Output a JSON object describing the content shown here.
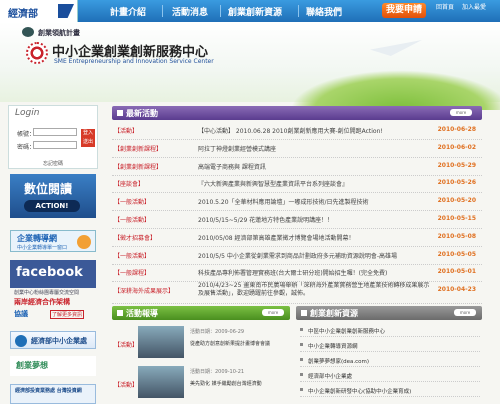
{
  "header": {
    "logo_label": "經濟部",
    "nav": [
      "計畫介紹",
      "活動消息",
      "創業創新資源",
      "聯絡我們"
    ],
    "apply_label": "我要申請",
    "util": [
      "回首頁",
      "加入最愛"
    ]
  },
  "hero": {
    "program": "創業領航計畫",
    "title": "中小企業創業創新服務中心",
    "title_en": "SME Entrepreneurship and Innovation Service Center"
  },
  "login": {
    "title": "Login",
    "account_label": "帳號：",
    "password_label": "密碼：",
    "submit_label": "登入 送出",
    "forgot_label": "忘記密碼"
  },
  "banners": {
    "reading": "數位閱讀",
    "reading_action": "ACTION!",
    "biz_title": "企業轉導網",
    "biz_sub": "中小企業轉導單一窗口",
    "facebook": "facebook",
    "facebook_sub": "創業中心粉絲團專屬交流空間",
    "cross_1": "兩岸經濟合作架構",
    "cross_2": "協議",
    "cross_3": "了解更多資訊",
    "moea": "經濟部中小企業處",
    "dream": "創業夢想",
    "eco": "經濟部投資業務處 台灣投資網"
  },
  "news": {
    "header": "最新活動",
    "more": "more",
    "rows": [
      {
        "cat": "【活動】",
        "title": "【中心活動】 2010.06.28 2010創業創新應用大賽-創位開跑Action!",
        "date": "2010-06-28"
      },
      {
        "cat": "【創業創新課程】",
        "title": "阿拉丁神燈創業經營模式講座",
        "date": "2010-06-02"
      },
      {
        "cat": "【創業創新課程】",
        "title": "高端電子商務與 課程資訊",
        "date": "2010-05-29"
      },
      {
        "cat": "【座談會】",
        "title": "『六大新興產業與新興智慧型產業資訊平台系列座談會』",
        "date": "2010-05-26"
      },
      {
        "cat": "【一般活動】",
        "title": "2010.5.20「全華材料應用論壇」一嘟成形技術/日先進製程技術",
        "date": "2010-05-20"
      },
      {
        "cat": "【一般活動】",
        "title": "2010/5/15~5/29 花蓮地方特色產業說明講座！！",
        "date": "2010-05-15"
      },
      {
        "cat": "【徵才招募會】",
        "title": "2010/05/08 經濟部第高雄產業徵才博覽會場地活動開幕！",
        "date": "2010-05-08"
      },
      {
        "cat": "【一般活動】",
        "title": "2010/5/5 中小企業從創業需求到商品計劃政府多元補助資源說明會-高雄場",
        "date": "2010-05-05"
      },
      {
        "cat": "【一般課程】",
        "title": "科技產品專利佈署管理實務班(台大爾士研分班)開始招生囉！(完全免費)",
        "date": "2010-05-01"
      },
      {
        "cat": "【深耕海外成果展示】",
        "title": "2010/4/23~25 畫東南市民廣場舉辦「深耕海外產業實務營生地產業技術轉移成果展示及展售活動」，歡迎踴躍前往參觀，誠佈。",
        "date": "2010-04-23"
      }
    ]
  },
  "activities": {
    "header": "活動報導",
    "more": "more",
    "items": [
      {
        "cat": "【活動】",
        "date": "活動日期：2009-06-29",
        "title": "從產助方創意創新果提計畫博會會議"
      },
      {
        "cat": "【活動】",
        "date": "活動日期：2009-10-21",
        "title": "美先勁化 媒手繼勵創台灣經濟動"
      }
    ]
  },
  "resources": {
    "header": "創業創新資源",
    "more": "more",
    "items": [
      "中區中小企業創業創新服務中心",
      "中小企業轉導資源網",
      "創業夢夢想家(dea.com)",
      "經濟部中小企業處",
      "中小企業創新研發中心(協助中小企業育成)"
    ]
  }
}
